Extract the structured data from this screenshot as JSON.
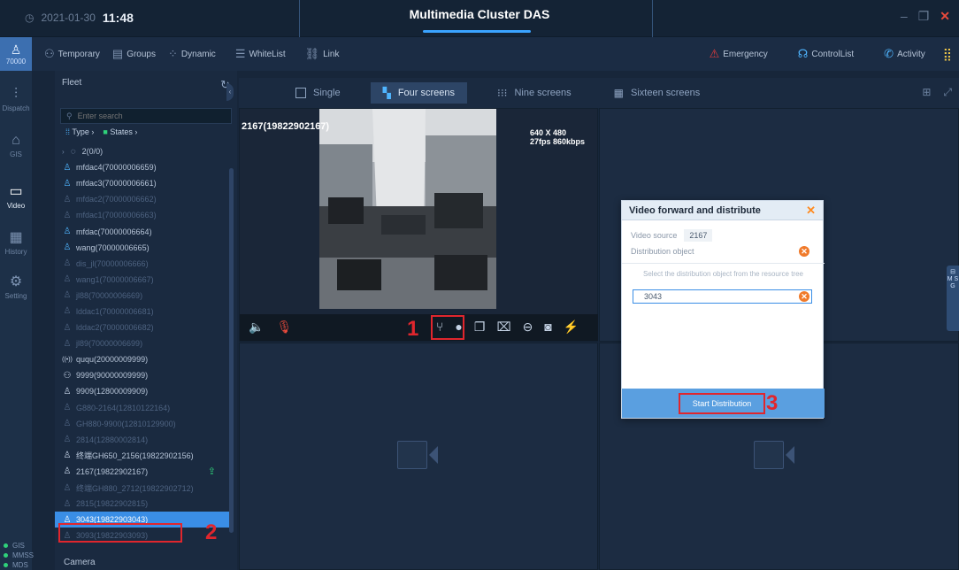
{
  "titlebar": {
    "date": "2021-01-30",
    "time": "11:48",
    "title": "Multimedia Cluster DAS"
  },
  "user": {
    "id": "70000"
  },
  "toolbar": {
    "temporary": "Temporary",
    "groups": "Groups",
    "dynamic": "Dynamic",
    "whitelist": "WhiteList",
    "link": "Link",
    "emergency": "Emergency",
    "controllist": "ControlList",
    "activity": "Activity"
  },
  "nav": {
    "dispatch": "Dispatch",
    "gis": "GIS",
    "video": "Video",
    "history": "History",
    "setting": "Setting"
  },
  "status": {
    "gis": "GIS",
    "mmss": "MMSS",
    "mds": "MDS"
  },
  "fleet": {
    "title": "Fleet",
    "search_placeholder": "Enter search",
    "filter_type": "Type",
    "filter_states": "States",
    "group": "2(0/0)",
    "items": [
      {
        "label": "mfdac4(70000006659)",
        "state": "online"
      },
      {
        "label": "mfdac3(70000006661)",
        "state": "online"
      },
      {
        "label": "mfdac2(70000006662)",
        "state": "offline"
      },
      {
        "label": "mfdac1(70000006663)",
        "state": "offline"
      },
      {
        "label": "mfdac(70000006664)",
        "state": "online"
      },
      {
        "label": "wang(70000006665)",
        "state": "online"
      },
      {
        "label": "dis_jl(70000006666)",
        "state": "offline"
      },
      {
        "label": "wang1(70000006667)",
        "state": "offline"
      },
      {
        "label": "jl88(70000006669)",
        "state": "offline"
      },
      {
        "label": "lddac1(70000006681)",
        "state": "offline"
      },
      {
        "label": "lddac2(70000006682)",
        "state": "offline"
      },
      {
        "label": "jl89(70000006699)",
        "state": "offline"
      },
      {
        "label": "ququ(20000009999)",
        "state": "radio"
      },
      {
        "label": "9999(90000009999)",
        "state": "group"
      },
      {
        "label": "9909(12800009909)",
        "state": "person"
      },
      {
        "label": "G880-2164(12810122164)",
        "state": "dim"
      },
      {
        "label": "GH880-9900(12810129900)",
        "state": "dim"
      },
      {
        "label": "2814(12880002814)",
        "state": "dim"
      },
      {
        "label": "终端GH650_2156(19822902156)",
        "state": "person"
      },
      {
        "label": "2167(19822902167)",
        "state": "person"
      },
      {
        "label": "终端GH880_2712(19822902712)",
        "state": "dim"
      },
      {
        "label": "2815(19822902815)",
        "state": "dim"
      },
      {
        "label": "3043(19822903043)",
        "state": "selected"
      },
      {
        "label": "3093(19822903093)",
        "state": "dim"
      }
    ],
    "camera_label": "Camera"
  },
  "viewtabs": {
    "single": "Single",
    "four": "Four screens",
    "nine": "Nine screens",
    "sixteen": "Sixteen screens"
  },
  "video": {
    "label": "2167(19822902167)",
    "resolution": "640 X 480",
    "stats": "27fps 860kbps"
  },
  "dialog": {
    "title": "Video forward and distribute",
    "source_label": "Video source",
    "source_value": "2167",
    "distribution_label": "Distribution object",
    "hint": "Select the distribution object from the resource tree",
    "object_value": "3043",
    "start_button": "Start Distribution"
  },
  "right_handle": "M S G",
  "annotations": {
    "n1": "1",
    "n2": "2",
    "n3": "3"
  },
  "colors": {
    "accent": "#3a8ee6",
    "annotation": "#e0262d",
    "dialog_close": "#ff8a1f"
  }
}
